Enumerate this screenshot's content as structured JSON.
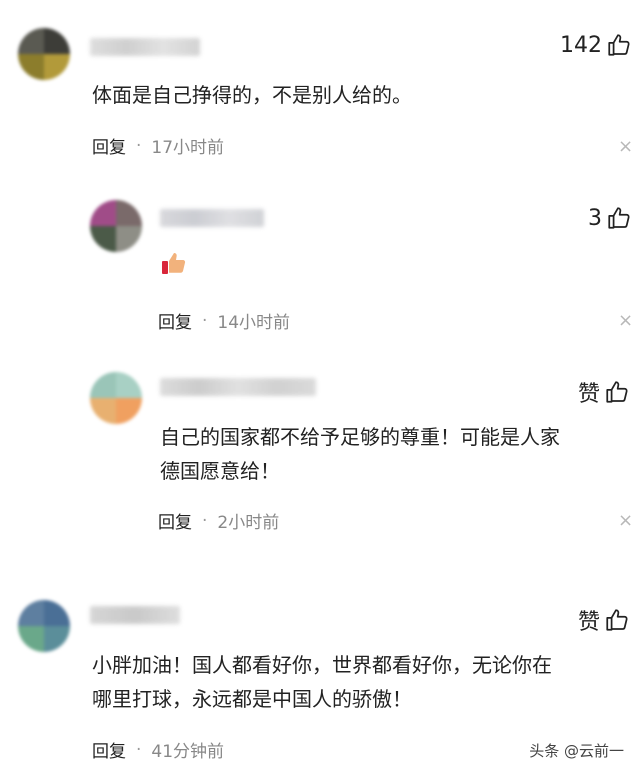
{
  "comments": [
    {
      "text": "体面是自己挣得的，不是别人给的。",
      "likes": "142",
      "reply_label": "回复",
      "time": "17小时前",
      "close": "×"
    },
    {
      "text": "",
      "likes": "3",
      "reply_label": "回复",
      "time": "14小时前",
      "close": "×"
    },
    {
      "text": "自己的国家都不给予足够的尊重！可能是人家\n德国愿意给！",
      "likes": "赞",
      "reply_label": "回复",
      "time": "2小时前",
      "close": "×"
    },
    {
      "text": "小胖加油！国人都看好你，世界都看好你，无论你在\n哪里打球，永远都是中国人的骄傲！",
      "likes": "赞",
      "reply_label": "回复",
      "time": "41分钟前",
      "close": "×"
    }
  ],
  "separator": "·",
  "watermark": "头条 @云前一"
}
